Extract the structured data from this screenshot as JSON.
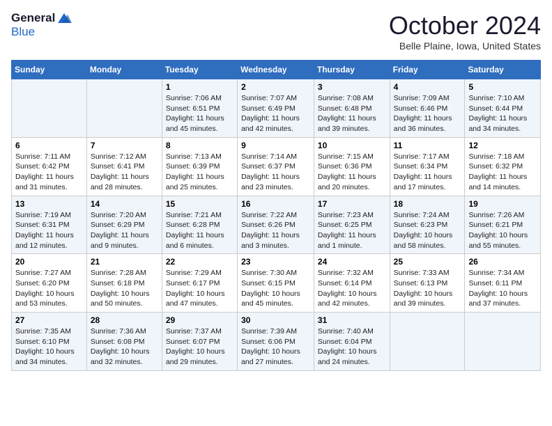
{
  "header": {
    "logo_general": "General",
    "logo_blue": "Blue",
    "month_title": "October 2024",
    "location": "Belle Plaine, Iowa, United States"
  },
  "weekdays": [
    "Sunday",
    "Monday",
    "Tuesday",
    "Wednesday",
    "Thursday",
    "Friday",
    "Saturday"
  ],
  "weeks": [
    [
      {
        "day": "",
        "sunrise": "",
        "sunset": "",
        "daylight": ""
      },
      {
        "day": "",
        "sunrise": "",
        "sunset": "",
        "daylight": ""
      },
      {
        "day": "1",
        "sunrise": "Sunrise: 7:06 AM",
        "sunset": "Sunset: 6:51 PM",
        "daylight": "Daylight: 11 hours and 45 minutes."
      },
      {
        "day": "2",
        "sunrise": "Sunrise: 7:07 AM",
        "sunset": "Sunset: 6:49 PM",
        "daylight": "Daylight: 11 hours and 42 minutes."
      },
      {
        "day": "3",
        "sunrise": "Sunrise: 7:08 AM",
        "sunset": "Sunset: 6:48 PM",
        "daylight": "Daylight: 11 hours and 39 minutes."
      },
      {
        "day": "4",
        "sunrise": "Sunrise: 7:09 AM",
        "sunset": "Sunset: 6:46 PM",
        "daylight": "Daylight: 11 hours and 36 minutes."
      },
      {
        "day": "5",
        "sunrise": "Sunrise: 7:10 AM",
        "sunset": "Sunset: 6:44 PM",
        "daylight": "Daylight: 11 hours and 34 minutes."
      }
    ],
    [
      {
        "day": "6",
        "sunrise": "Sunrise: 7:11 AM",
        "sunset": "Sunset: 6:42 PM",
        "daylight": "Daylight: 11 hours and 31 minutes."
      },
      {
        "day": "7",
        "sunrise": "Sunrise: 7:12 AM",
        "sunset": "Sunset: 6:41 PM",
        "daylight": "Daylight: 11 hours and 28 minutes."
      },
      {
        "day": "8",
        "sunrise": "Sunrise: 7:13 AM",
        "sunset": "Sunset: 6:39 PM",
        "daylight": "Daylight: 11 hours and 25 minutes."
      },
      {
        "day": "9",
        "sunrise": "Sunrise: 7:14 AM",
        "sunset": "Sunset: 6:37 PM",
        "daylight": "Daylight: 11 hours and 23 minutes."
      },
      {
        "day": "10",
        "sunrise": "Sunrise: 7:15 AM",
        "sunset": "Sunset: 6:36 PM",
        "daylight": "Daylight: 11 hours and 20 minutes."
      },
      {
        "day": "11",
        "sunrise": "Sunrise: 7:17 AM",
        "sunset": "Sunset: 6:34 PM",
        "daylight": "Daylight: 11 hours and 17 minutes."
      },
      {
        "day": "12",
        "sunrise": "Sunrise: 7:18 AM",
        "sunset": "Sunset: 6:32 PM",
        "daylight": "Daylight: 11 hours and 14 minutes."
      }
    ],
    [
      {
        "day": "13",
        "sunrise": "Sunrise: 7:19 AM",
        "sunset": "Sunset: 6:31 PM",
        "daylight": "Daylight: 11 hours and 12 minutes."
      },
      {
        "day": "14",
        "sunrise": "Sunrise: 7:20 AM",
        "sunset": "Sunset: 6:29 PM",
        "daylight": "Daylight: 11 hours and 9 minutes."
      },
      {
        "day": "15",
        "sunrise": "Sunrise: 7:21 AM",
        "sunset": "Sunset: 6:28 PM",
        "daylight": "Daylight: 11 hours and 6 minutes."
      },
      {
        "day": "16",
        "sunrise": "Sunrise: 7:22 AM",
        "sunset": "Sunset: 6:26 PM",
        "daylight": "Daylight: 11 hours and 3 minutes."
      },
      {
        "day": "17",
        "sunrise": "Sunrise: 7:23 AM",
        "sunset": "Sunset: 6:25 PM",
        "daylight": "Daylight: 11 hours and 1 minute."
      },
      {
        "day": "18",
        "sunrise": "Sunrise: 7:24 AM",
        "sunset": "Sunset: 6:23 PM",
        "daylight": "Daylight: 10 hours and 58 minutes."
      },
      {
        "day": "19",
        "sunrise": "Sunrise: 7:26 AM",
        "sunset": "Sunset: 6:21 PM",
        "daylight": "Daylight: 10 hours and 55 minutes."
      }
    ],
    [
      {
        "day": "20",
        "sunrise": "Sunrise: 7:27 AM",
        "sunset": "Sunset: 6:20 PM",
        "daylight": "Daylight: 10 hours and 53 minutes."
      },
      {
        "day": "21",
        "sunrise": "Sunrise: 7:28 AM",
        "sunset": "Sunset: 6:18 PM",
        "daylight": "Daylight: 10 hours and 50 minutes."
      },
      {
        "day": "22",
        "sunrise": "Sunrise: 7:29 AM",
        "sunset": "Sunset: 6:17 PM",
        "daylight": "Daylight: 10 hours and 47 minutes."
      },
      {
        "day": "23",
        "sunrise": "Sunrise: 7:30 AM",
        "sunset": "Sunset: 6:15 PM",
        "daylight": "Daylight: 10 hours and 45 minutes."
      },
      {
        "day": "24",
        "sunrise": "Sunrise: 7:32 AM",
        "sunset": "Sunset: 6:14 PM",
        "daylight": "Daylight: 10 hours and 42 minutes."
      },
      {
        "day": "25",
        "sunrise": "Sunrise: 7:33 AM",
        "sunset": "Sunset: 6:13 PM",
        "daylight": "Daylight: 10 hours and 39 minutes."
      },
      {
        "day": "26",
        "sunrise": "Sunrise: 7:34 AM",
        "sunset": "Sunset: 6:11 PM",
        "daylight": "Daylight: 10 hours and 37 minutes."
      }
    ],
    [
      {
        "day": "27",
        "sunrise": "Sunrise: 7:35 AM",
        "sunset": "Sunset: 6:10 PM",
        "daylight": "Daylight: 10 hours and 34 minutes."
      },
      {
        "day": "28",
        "sunrise": "Sunrise: 7:36 AM",
        "sunset": "Sunset: 6:08 PM",
        "daylight": "Daylight: 10 hours and 32 minutes."
      },
      {
        "day": "29",
        "sunrise": "Sunrise: 7:37 AM",
        "sunset": "Sunset: 6:07 PM",
        "daylight": "Daylight: 10 hours and 29 minutes."
      },
      {
        "day": "30",
        "sunrise": "Sunrise: 7:39 AM",
        "sunset": "Sunset: 6:06 PM",
        "daylight": "Daylight: 10 hours and 27 minutes."
      },
      {
        "day": "31",
        "sunrise": "Sunrise: 7:40 AM",
        "sunset": "Sunset: 6:04 PM",
        "daylight": "Daylight: 10 hours and 24 minutes."
      },
      {
        "day": "",
        "sunrise": "",
        "sunset": "",
        "daylight": ""
      },
      {
        "day": "",
        "sunrise": "",
        "sunset": "",
        "daylight": ""
      }
    ]
  ]
}
